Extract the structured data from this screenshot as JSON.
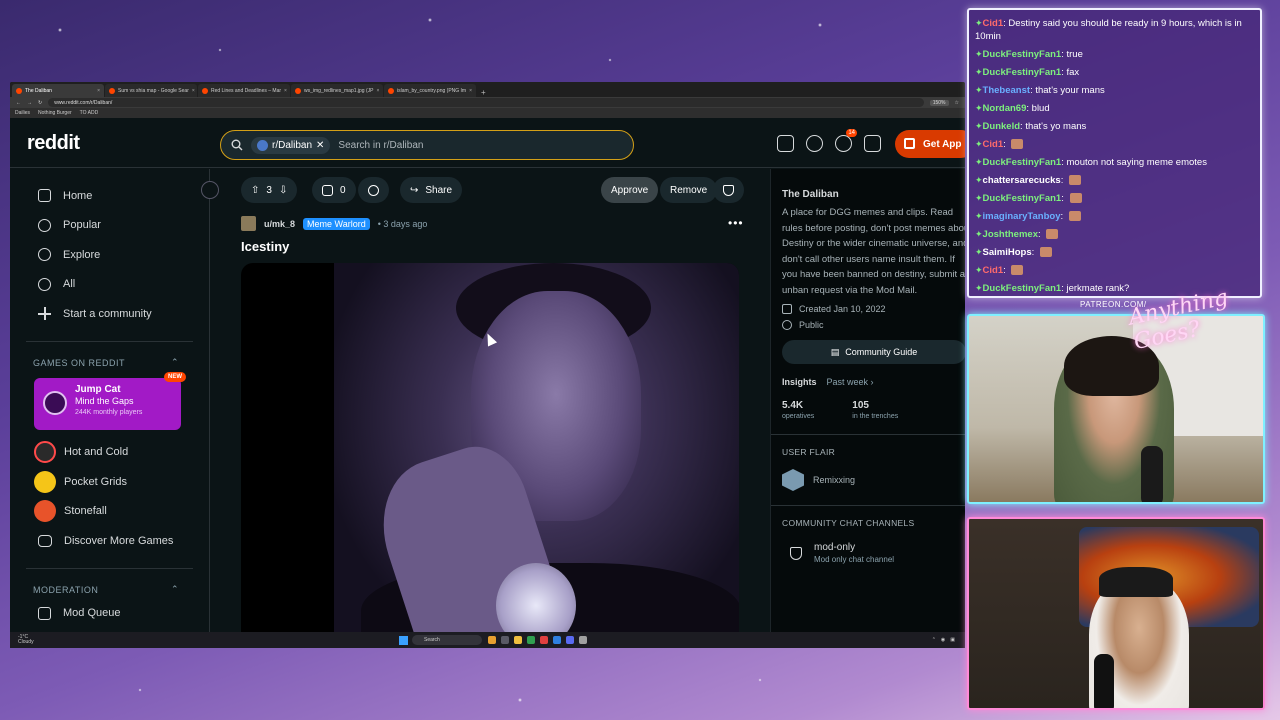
{
  "browser": {
    "tabs": [
      {
        "label": "The Daliban",
        "active": true
      },
      {
        "label": "Sum vs shia map - Google Sear",
        "active": false
      },
      {
        "label": "Red Lines and Deadlines – Mar",
        "active": false
      },
      {
        "label": "ws_img_redlines_map1.jpg (JP",
        "active": false
      },
      {
        "label": "islam_by_country.png (PNG Im",
        "active": false
      }
    ],
    "url": "www.reddit.com/r/Daliban/",
    "zoom": "150%",
    "bookmarks": [
      "Dailies",
      "Nothing Burger",
      "TO ADD"
    ]
  },
  "reddit": {
    "logo": "reddit",
    "search": {
      "community_chip": "r/Daliban",
      "placeholder": "Search in r/Daliban"
    },
    "notif_count": "14",
    "get_app": "Get App",
    "nav": [
      {
        "label": "Home",
        "icon": "home-icon"
      },
      {
        "label": "Popular",
        "icon": "popular-icon"
      },
      {
        "label": "Explore",
        "icon": "explore-icon"
      },
      {
        "label": "All",
        "icon": "all-icon"
      },
      {
        "label": "Start a community",
        "icon": "plus-icon"
      }
    ],
    "games_section": "GAMES ON REDDIT",
    "featured_game": {
      "title": "Jump Cat",
      "subtitle": "Mind the Gaps",
      "players": "244K monthly players",
      "badge": "NEW"
    },
    "games": [
      {
        "label": "Hot and Cold",
        "color": "#2a2a2a"
      },
      {
        "label": "Pocket Grids",
        "color": "#f5c518"
      },
      {
        "label": "Stonefall",
        "color": "#e8532a"
      },
      {
        "label": "Discover More Games",
        "color": ""
      }
    ],
    "moderation_section": "MODERATION",
    "mod_queue": "Mod Queue",
    "post": {
      "votes": "3",
      "comments": "0",
      "share": "Share",
      "approve": "Approve",
      "remove": "Remove",
      "author": "u/mk_8",
      "flair": "Meme Warlord",
      "ago": "• 3 days ago",
      "title": "Icestiny"
    },
    "community": {
      "name": "The Daliban",
      "description": "A place for DGG memes and clips. Read rules before posting, don't post memes about Destiny or the wider cinematic universe, and don't call other users name insult them. If you have been banned on destiny, submit an unban request via the Mod Mail.",
      "created": "Created Jan 10, 2022",
      "visibility": "Public",
      "guide_button": "Community Guide",
      "insights_label": "Insights",
      "insights_range": "Past week ›",
      "stats": [
        {
          "value": "5.4K",
          "label": "operatives"
        },
        {
          "value": "105",
          "label": "in the trenches"
        }
      ],
      "user_flair_label": "USER FLAIR",
      "user_flair": "Remixxing",
      "chat_label": "COMMUNITY CHAT CHANNELS",
      "channel_name": "mod-only",
      "channel_desc": "Mod only chat channel"
    }
  },
  "taskbar": {
    "weather_temp": "-1°C",
    "weather_desc": "Cloudy",
    "search": "Search"
  },
  "chat": [
    {
      "user": "Cid1",
      "color": "#ff6b6b",
      "text": "Destiny said you should be ready in 9 hours, which is in 10min"
    },
    {
      "user": "DuckFestinyFan1",
      "color": "#7df07d",
      "text": "true"
    },
    {
      "user": "DuckFestinyFan1",
      "color": "#7df07d",
      "text": "fax"
    },
    {
      "user": "Thebeanst",
      "color": "#6ab0ff",
      "text": "that's your mans"
    },
    {
      "user": "Nordan69",
      "color": "#7df07d",
      "text": "blud"
    },
    {
      "user": "Dunkeld",
      "color": "#7df07d",
      "text": "that's yo mans"
    },
    {
      "user": "Cid1",
      "color": "#ff6b6b",
      "text": ""
    },
    {
      "user": "DuckFestinyFan1",
      "color": "#7df07d",
      "text": "mouton not saying meme emotes"
    },
    {
      "user": "chattersarecucks",
      "color": "#ffffff",
      "text": ""
    },
    {
      "user": "DuckFestinyFan1",
      "color": "#7df07d",
      "text": ""
    },
    {
      "user": "imaginaryTanboy",
      "color": "#6ab0ff",
      "text": ""
    },
    {
      "user": "Joshthemex",
      "color": "#7df07d",
      "text": ""
    },
    {
      "user": "SaimiHops",
      "color": "#ffffff",
      "text": ""
    },
    {
      "user": "Cid1",
      "color": "#ff6b6b",
      "text": ""
    },
    {
      "user": "DuckFestinyFan1",
      "color": "#7df07d",
      "text": "jerkmate rank?"
    }
  ],
  "overlay": {
    "patreon": "PATREON.COM/",
    "signature": "Anything Goes?"
  }
}
